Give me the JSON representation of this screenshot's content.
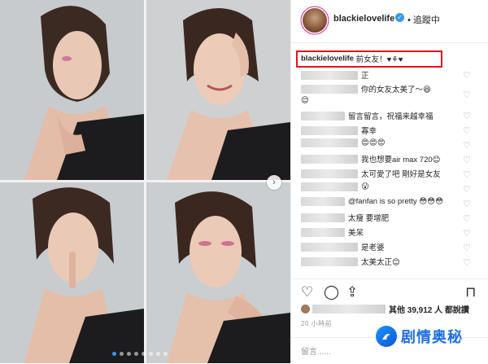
{
  "account": {
    "username": "blackielovelife",
    "follow_status": "追蹤中",
    "separator": "•",
    "verified_glyph": "✓"
  },
  "caption": {
    "username": "blackielovelife",
    "text": "前女友！♥⚘♥"
  },
  "comments": [
    {
      "text": "正"
    },
    {
      "text": "你的女友太美了～😆"
    },
    {
      "text": "😌"
    },
    {
      "text": "留言留言，祝福来越幸福"
    },
    {
      "text": "寡幸"
    },
    {
      "text": "😍😍😍"
    },
    {
      "text": "我也想要air max 720😊"
    },
    {
      "text": "太可愛了吧 剛好是女友"
    },
    {
      "text": "😮"
    },
    {
      "text": "@fanfan is so pretty 😳😳😳"
    },
    {
      "text": "太瘦 要增肥"
    },
    {
      "text": "美呆"
    },
    {
      "text": "是老婆"
    },
    {
      "text": "太美太正😊"
    }
  ],
  "likes": {
    "text": "其他 39,912 人 都說讚"
  },
  "timestamp": "20 小時前",
  "comment_input": {
    "placeholder": "留言......"
  },
  "watermark": {
    "text": "剧情奥秘"
  },
  "carousel": {
    "total_dots": 8,
    "active_index": 0
  },
  "icons": {
    "heart": "heart-icon",
    "comment": "comment-icon",
    "share": "share-icon",
    "save": "bookmark-icon",
    "next": "chevron-right-icon"
  },
  "colors": {
    "highlight_box": "#e0141e",
    "verified": "#3897f0",
    "watermark": "#1f6fe6"
  }
}
